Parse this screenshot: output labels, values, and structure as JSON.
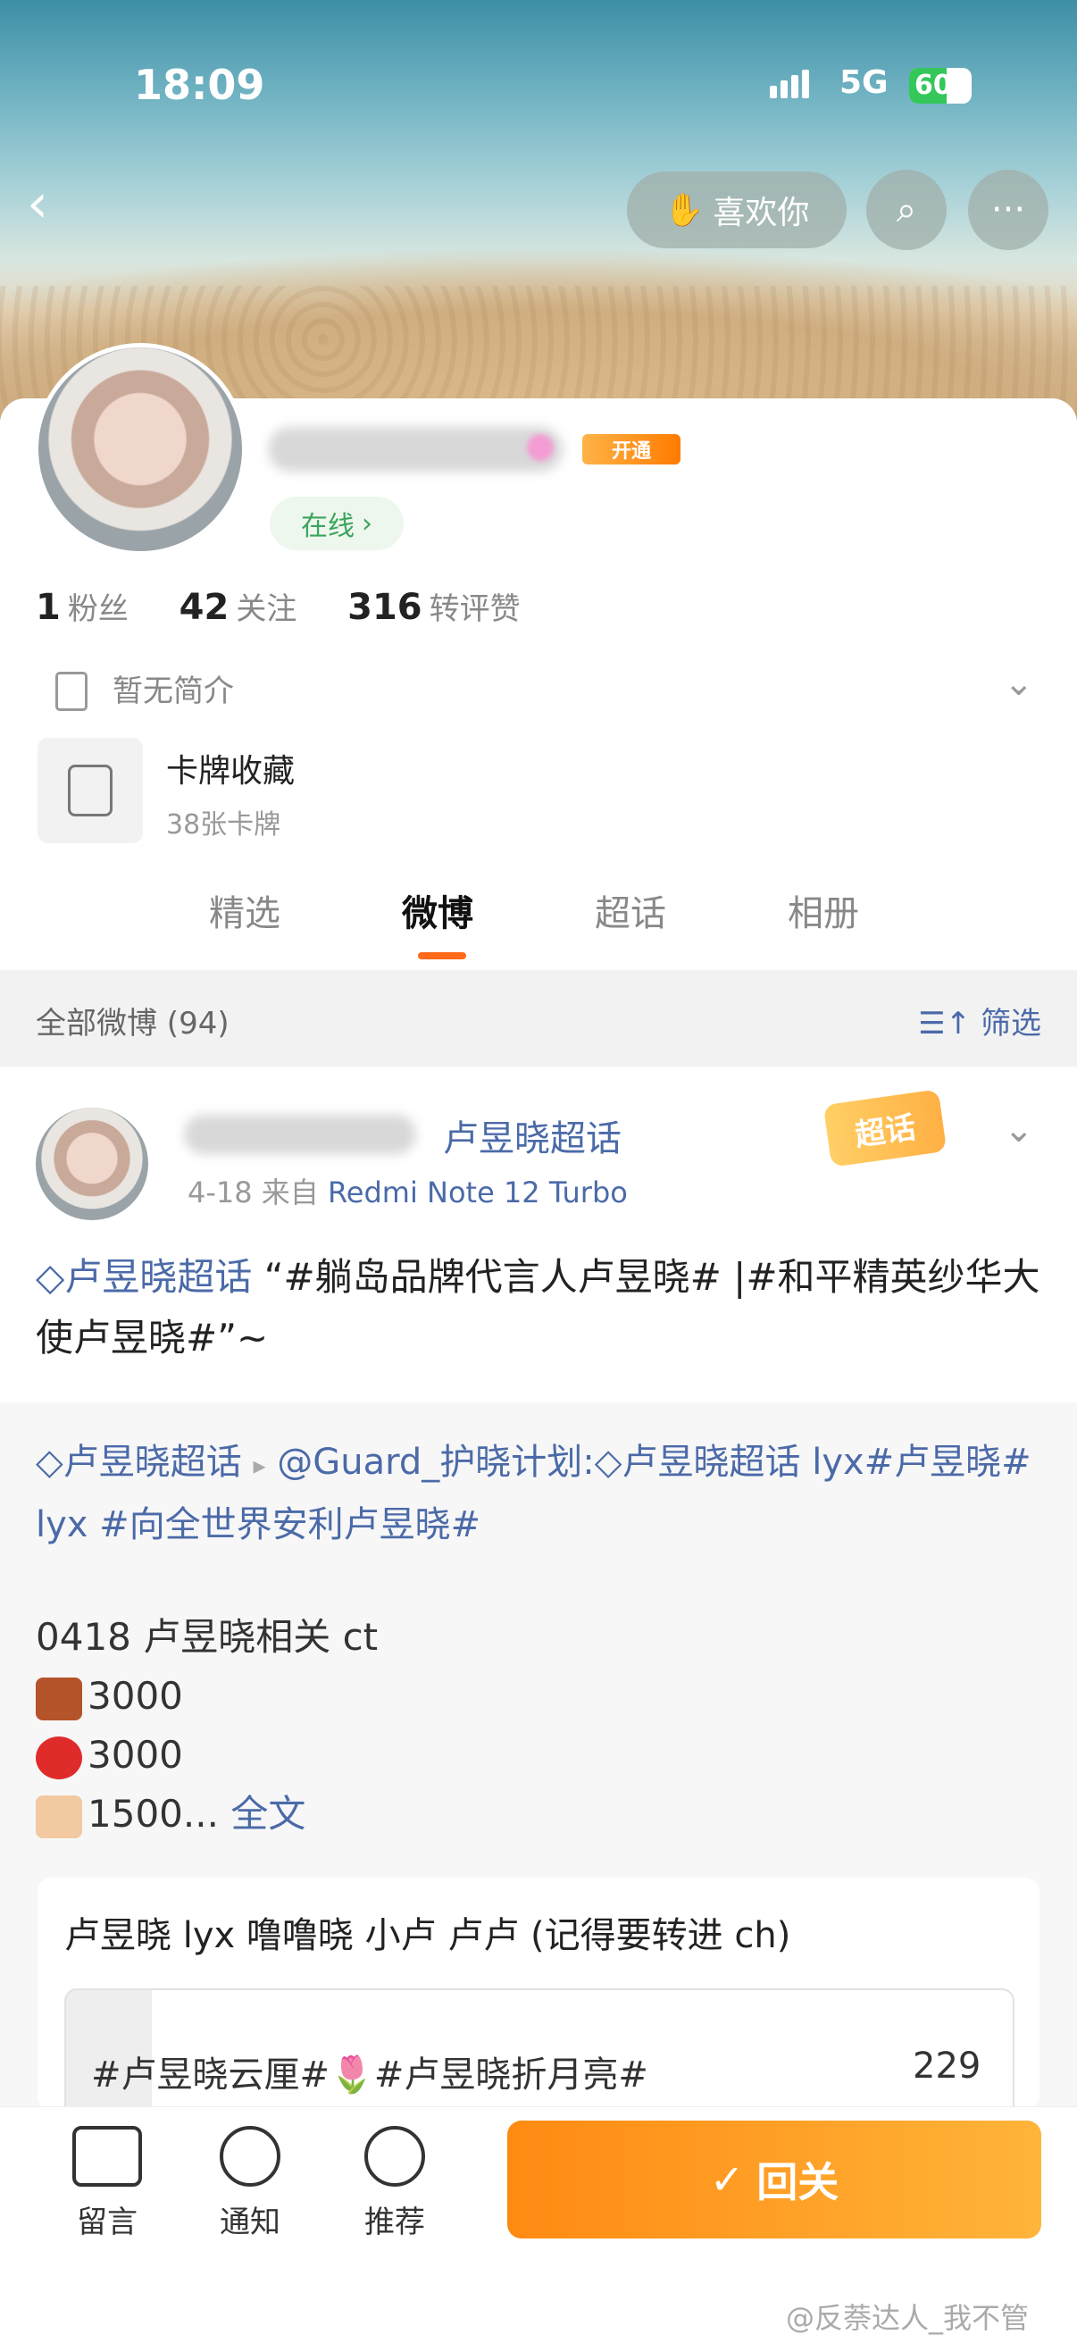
{
  "status": {
    "time": "18:09",
    "network": "5G",
    "battery": "60",
    "battery_level": 0.6
  },
  "header": {
    "like_label": "喜欢你"
  },
  "profile": {
    "vip_label": "开通",
    "online_label": "在线",
    "online_chevron": "›",
    "stats": [
      {
        "count": "1",
        "label": "粉丝"
      },
      {
        "count": "42",
        "label": "关注"
      },
      {
        "count": "316",
        "label": "转评赞"
      }
    ],
    "bio": "暂无简介",
    "cards": {
      "title": "卡牌收藏",
      "subtitle": "38张卡牌"
    }
  },
  "tabs": [
    "精选",
    "微博",
    "超话",
    "相册"
  ],
  "filter": {
    "left": "全部微博 (94)",
    "right": "筛选"
  },
  "post": {
    "name": "卢昱晓超话",
    "date": "4-18",
    "from": "来自",
    "device": "Redmi Note 12 Turbo",
    "tag": "超话",
    "text_topic": "卢昱晓超话",
    "text_quote": "“#躺岛品牌代言人卢昱晓# |#和平精英纱华大使卢昱晓#”~"
  },
  "repost": {
    "topic": "卢昱晓超话",
    "arrow": "▸",
    "mention": "@Guard_护晓计划:",
    "topic2": "卢昱晓超话",
    "line_rest": " lyx#卢昱晓# lyx #向全世界安利卢昱晓#",
    "body_title": "0418 卢昱晓相关 ct",
    "items": [
      "3000",
      "3000",
      "1500..."
    ],
    "more": "全文",
    "box_title": "卢昱晓 lyx 噜噜晓 小卢 卢卢 (记得要转进 ch)",
    "box_topic": "#卢昱晓云厘#🌷#卢昱晓折月亮#",
    "box_count": "229"
  },
  "bottom": {
    "items": [
      {
        "label": "留言",
        "icon": "message-icon"
      },
      {
        "label": "通知",
        "icon": "bell-icon"
      },
      {
        "label": "推荐",
        "icon": "chevron-up-icon"
      }
    ],
    "primary": "回关"
  },
  "watermark": "@反萘达人_我不管"
}
